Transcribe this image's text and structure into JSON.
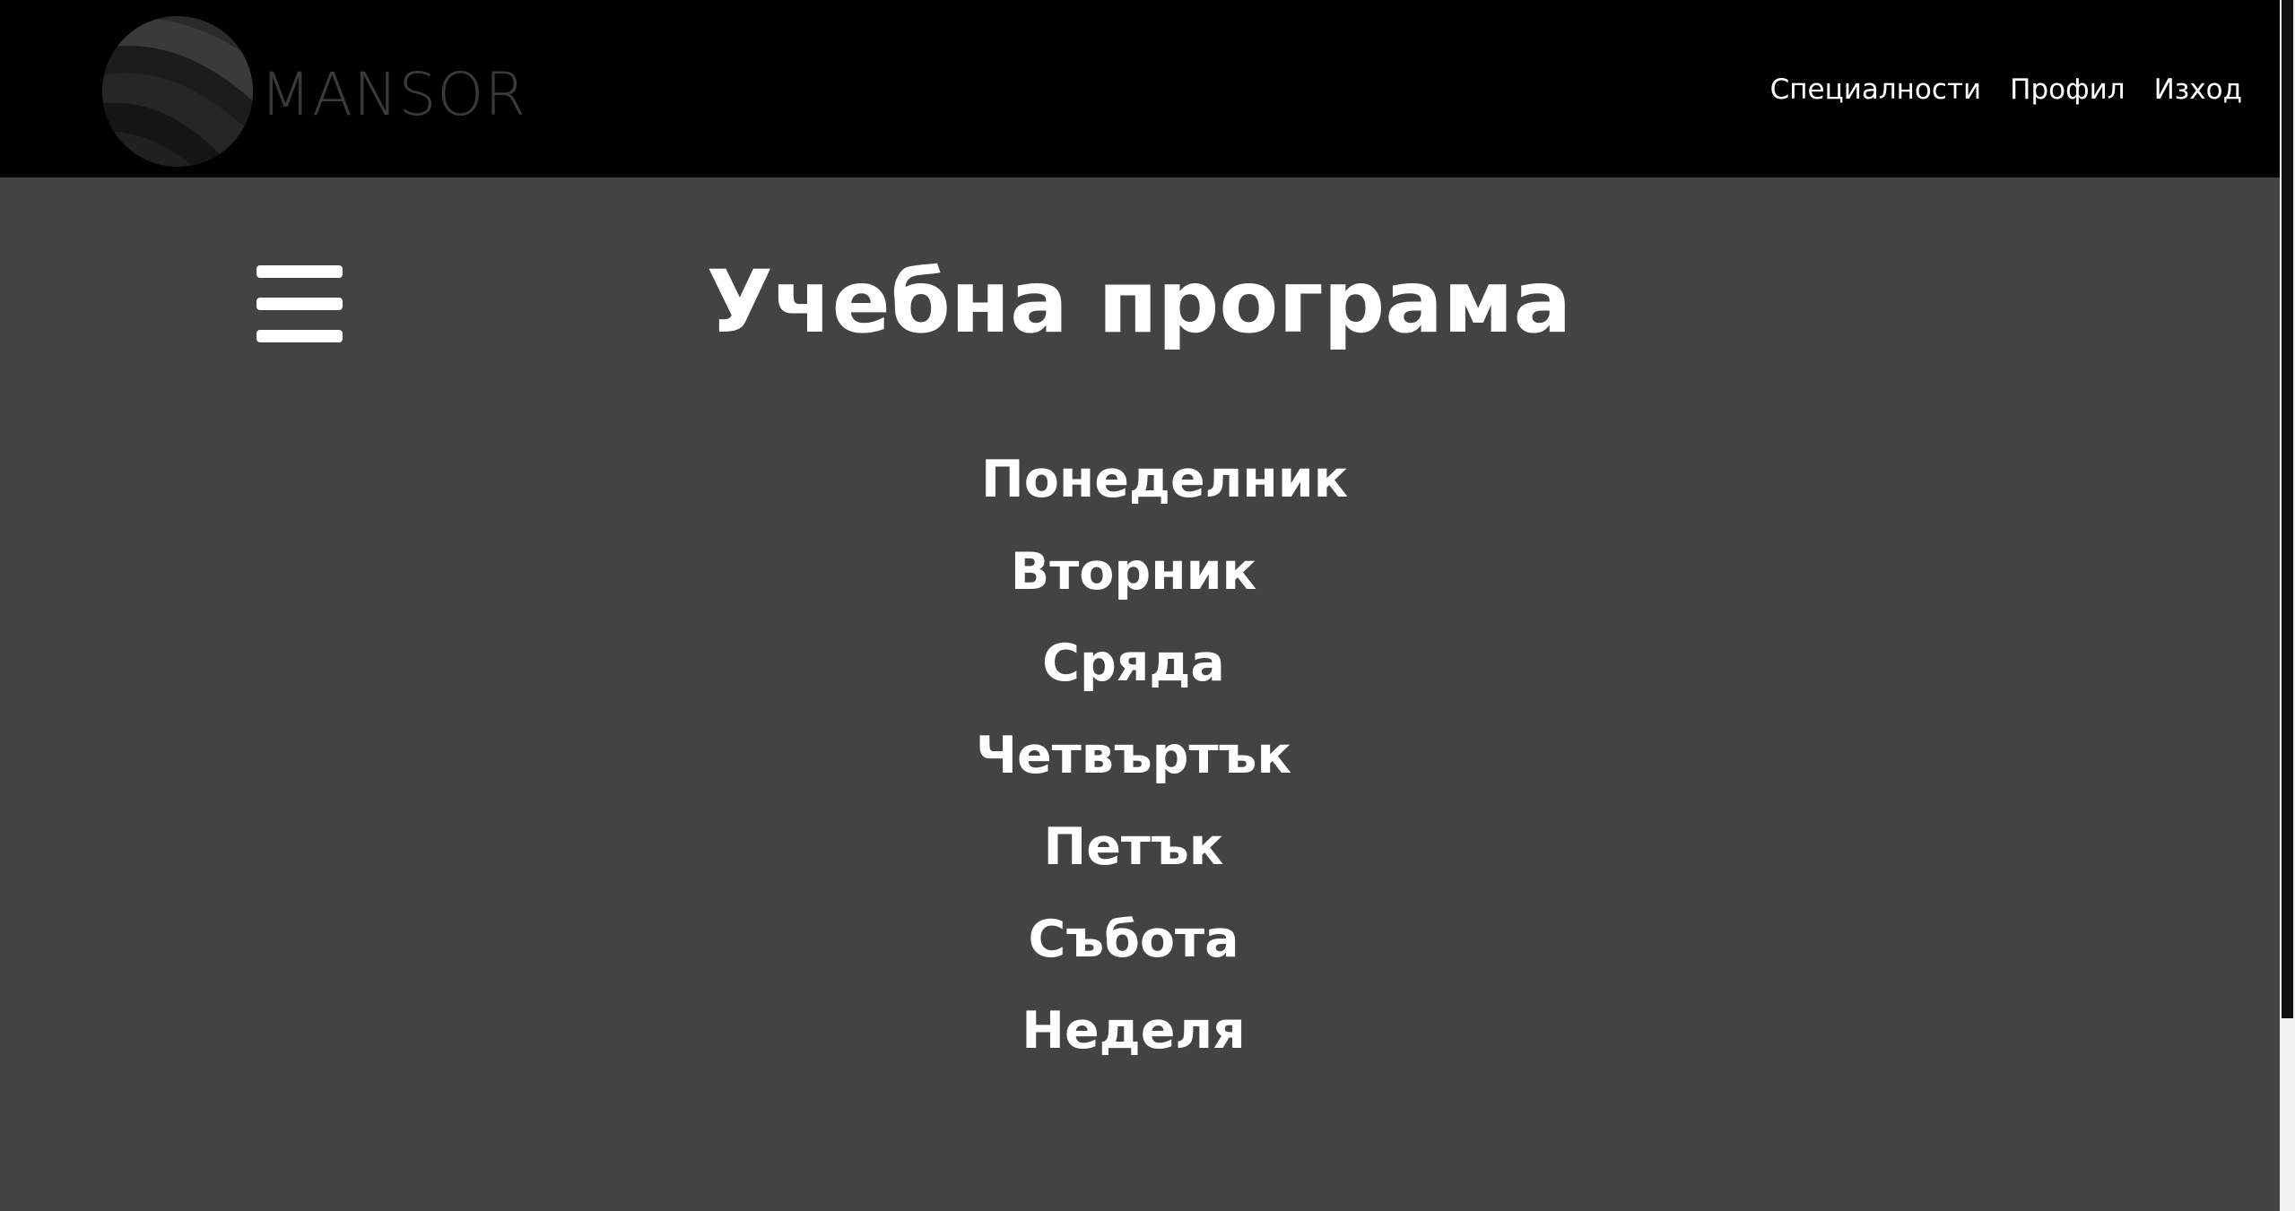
{
  "brand": {
    "logo_text": "MANSOR"
  },
  "nav": {
    "items": [
      {
        "label": "Специалности"
      },
      {
        "label": "Профил"
      },
      {
        "label": "Изход"
      }
    ]
  },
  "main": {
    "title": "Учебна програма",
    "menu_icon": "hamburger-menu-icon",
    "days": [
      {
        "label": "Понеделник"
      },
      {
        "label": "Вторник"
      },
      {
        "label": "Сряда"
      },
      {
        "label": "Четвъртък"
      },
      {
        "label": "Петък"
      },
      {
        "label": "Събота"
      },
      {
        "label": "Неделя"
      }
    ]
  },
  "colors": {
    "header_bg": "#000000",
    "page_bg": "#434343",
    "text": "#ffffff",
    "logo_text": "#3a3a3a"
  }
}
